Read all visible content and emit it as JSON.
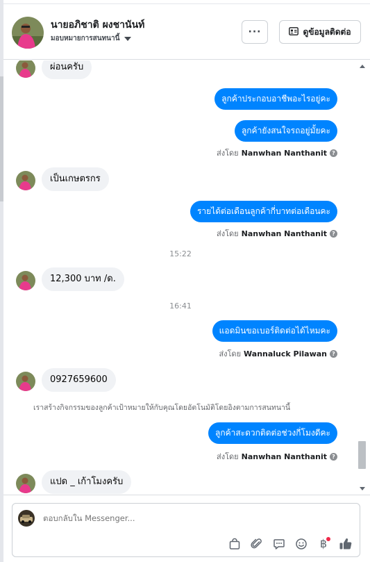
{
  "header": {
    "contact_name": "นายอภิชาติ ผงชานันท์",
    "assign_label": "มอบหมายการสนทนานี้",
    "more_label": "···",
    "view_contact_label": "ดูข้อมูลติดต่อ"
  },
  "thread": {
    "msg1": "ผ่อนครับ",
    "msg2": "ลูกค้าประกอบอาชีพอะไรอยู่คะ",
    "msg3": "ลูกค้ายังสนใจรถอยู่มั้ยคะ",
    "sent_by_1": {
      "prefix": "ส่งโดย",
      "name": "Nanwhan Nanthanit"
    },
    "msg4": "เป็นเกษตรกร",
    "msg5": "รายได้ต่อเดือนลูกค้ากี่บาทต่อเดือนคะ",
    "sent_by_2": {
      "prefix": "ส่งโดย",
      "name": "Nanwhan Nanthanit"
    },
    "time1": "15:22",
    "msg6": "12,300  บาท /ด.",
    "time2": "16:41",
    "msg7": "แอดมินขอเบอร์ติดต่อได้ไหมคะ",
    "sent_by_3": {
      "prefix": "ส่งโดย",
      "name": "Wannaluck Pilawan"
    },
    "msg8": "0927659600",
    "system_note": "เราสร้างกิจกรรมของลูกค้าเป้าหมายให้กับคุณโดยอัตโนมัติโดยอิงตามการสนทนานี้",
    "msg9": "ลูกค้าสะดวกติดต่อช่วงกี่โมงดีคะ",
    "sent_by_4": {
      "prefix": "ส่งโดย",
      "name": "Nanwhan Nanthanit"
    },
    "msg10": "แปด _ เก้าโมงครับ"
  },
  "composer": {
    "placeholder": "ตอบกลับใน Messenger...",
    "currency_symbol": "฿"
  },
  "icons": {
    "help": "?",
    "info_card": "contact-card-icon",
    "toolbar": [
      "shopping-bag-icon",
      "paperclip-icon",
      "saved-reply-icon",
      "emoji-icon",
      "payment-icon",
      "thumbs-up-icon"
    ]
  },
  "colors": {
    "outgoing_bubble": "#0084ff",
    "incoming_bubble": "#f0f2f5",
    "notification_dot": "#f02849"
  }
}
